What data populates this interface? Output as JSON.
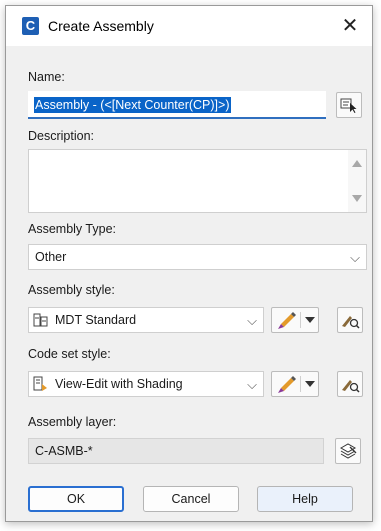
{
  "window": {
    "title": "Create Assembly",
    "app_icon_letter": "C",
    "close_glyph": "✕"
  },
  "name": {
    "label": "Name:",
    "value": "Assembly - (<[Next Counter(CP)]>)"
  },
  "description": {
    "label": "Description:",
    "value": ""
  },
  "assembly_type": {
    "label": "Assembly Type:",
    "selected": "Other"
  },
  "assembly_style": {
    "label": "Assembly style:",
    "selected": "MDT Standard"
  },
  "code_set_style": {
    "label": "Code set style:",
    "selected": "View-Edit with Shading"
  },
  "assembly_layer": {
    "label": "Assembly layer:",
    "value": "C-ASMB-*"
  },
  "buttons": {
    "ok": "OK",
    "cancel": "Cancel",
    "help": "Help"
  },
  "icons": [
    "app-icon",
    "close-icon",
    "name-template-icon",
    "scroll-up-icon",
    "scroll-down-icon",
    "chevron-down-icon",
    "assembly-style-icon",
    "code-set-style-icon",
    "edit-style-icon",
    "preview-style-icon",
    "layer-icon"
  ],
  "colors": {
    "accent": "#0a64c8",
    "dialog_bg": "#f0f0f0",
    "primary_border": "#2a6fd1"
  }
}
